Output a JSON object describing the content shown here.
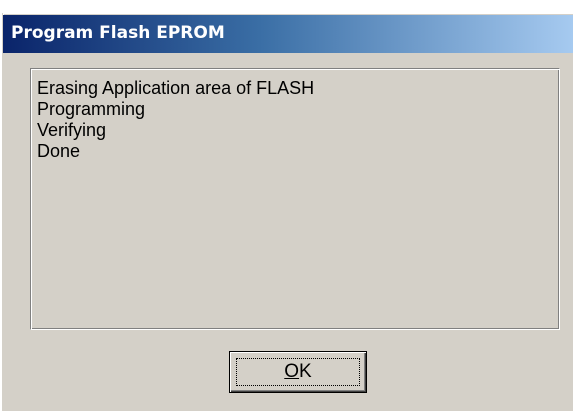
{
  "window": {
    "title": "Program Flash EPROM"
  },
  "log": {
    "lines": [
      "Erasing Application area of FLASH",
      "Programming",
      "Verifying",
      "Done"
    ]
  },
  "ok_button": {
    "label": "OK",
    "mnemonic": "O",
    "rest": "K"
  }
}
